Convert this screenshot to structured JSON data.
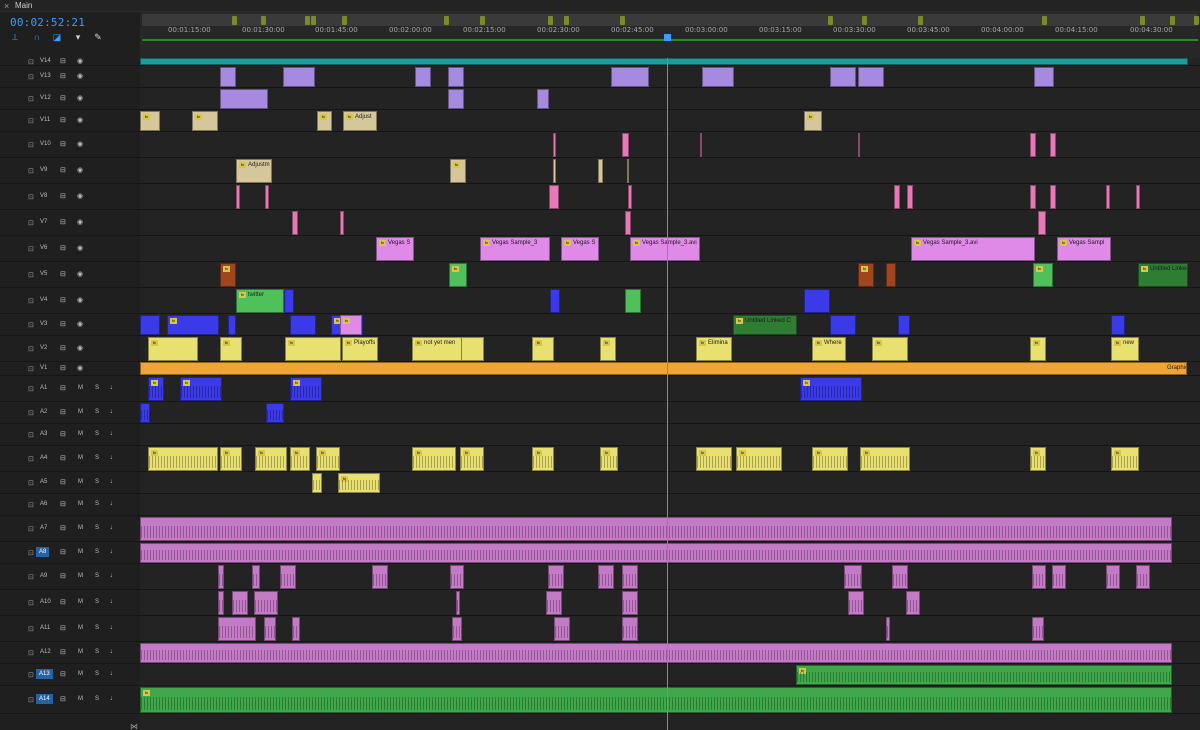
{
  "panel": {
    "close_label": "×",
    "title": "Main"
  },
  "timecode": "00:02:52:21",
  "tools": [
    "snap-icon",
    "link-icon",
    "marker-add-icon",
    "flag-icon",
    "wrench-icon"
  ],
  "ruler_labels": [
    "00:01:15:00",
    "00:01:30:00",
    "00:01:45:00",
    "00:02:00:00",
    "00:02:15:00",
    "00:02:30:00",
    "00:02:45:00",
    "00:03:00:00",
    "00:03:15:00",
    "00:03:30:00",
    "00:03:45:00",
    "00:04:00:00",
    "00:04:15:00",
    "00:04:30:00"
  ],
  "video_tracks": [
    {
      "name": "V14"
    },
    {
      "name": "V13"
    },
    {
      "name": "V12"
    },
    {
      "name": "V11"
    },
    {
      "name": "V10"
    },
    {
      "name": "V9"
    },
    {
      "name": "V8"
    },
    {
      "name": "V7"
    },
    {
      "name": "V6"
    },
    {
      "name": "V5"
    },
    {
      "name": "V4"
    },
    {
      "name": "V3"
    },
    {
      "name": "V2"
    },
    {
      "name": "V1"
    }
  ],
  "audio_tracks": [
    {
      "name": "A1"
    },
    {
      "name": "A2"
    },
    {
      "name": "A3"
    },
    {
      "name": "A4"
    },
    {
      "name": "A5"
    },
    {
      "name": "A6"
    },
    {
      "name": "A7"
    },
    {
      "name": "A8",
      "selected": true
    },
    {
      "name": "A9"
    },
    {
      "name": "A10"
    },
    {
      "name": "A11"
    },
    {
      "name": "A12"
    },
    {
      "name": "A13",
      "selected": true
    },
    {
      "name": "A14",
      "selected": true
    }
  ],
  "audio_labels": {
    "mute": "M",
    "solo": "S"
  },
  "clip_labels": {
    "adjust": "Adjust",
    "adjustm": "Adjustm",
    "vegas_s": "Vegas S",
    "vegas_sample_3": "Vegas Sample_3",
    "vegas_s2": "Vegas S",
    "vegas_sample_3_avi": "Vegas Sample_3.avi",
    "vegas_sample_3_avi_2": "Vegas Sample_3.avi",
    "vegas_sample": "Vegas Sampl",
    "untitled_linked": "Untitled Linked",
    "twitter": "twitter",
    "untitled_linked_c": "Untitled Linked C",
    "playoffs": "Playoffs",
    "not_yet": "not yet men",
    "elimina": "Elimina",
    "where": "Where",
    "new": "new",
    "graphic": "Graphic"
  },
  "colors": {
    "accent": "#3b9bff",
    "teal": "#1f9b9b",
    "lavender": "#a58ae0",
    "tan": "#d6c79a",
    "pink": "#e879b6",
    "violet_clip": "#e08ae8",
    "green": "#4fc05a",
    "dark_green": "#2e7d32",
    "brown": "#a0461e",
    "blue": "#3a3ae8",
    "yellow": "#e8e070",
    "orange": "#eea534",
    "audio_pink": "#c57ac8",
    "audio_green": "#3fa84a"
  }
}
